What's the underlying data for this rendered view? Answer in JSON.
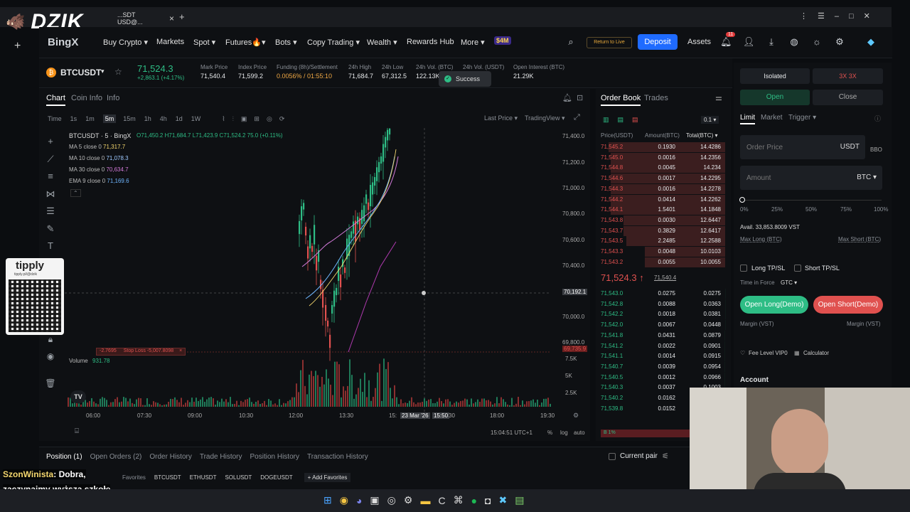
{
  "overlay": {
    "brand": "DZIK",
    "tippy": "tipply",
    "tippy_url": "tipply.pl/@dzik",
    "chat_user": "SzonWinista",
    "chat_msg": ": Dobra, zaczynajmy wyższą szkołę druciarstwa"
  },
  "browser": {
    "tab_title": "...SDT USD@...",
    "close": "×",
    "new_tab": "+"
  },
  "nav": {
    "logo": "BingX",
    "items": [
      "Buy Crypto ▾",
      "Markets",
      "Spot ▾",
      "Futures🔥▾",
      "Bots ▾",
      "Copy Trading ▾",
      "Wealth ▾",
      "Rewards Hub",
      "More ▾"
    ],
    "promo": "$4M",
    "return_live": "Return to Live",
    "deposit": "Deposit",
    "assets": "Assets",
    "notif_count": "11"
  },
  "ticker": {
    "pair": "BTCUSDT",
    "price": "71,524.3",
    "change": "+2,863.1 (+4.17%)",
    "fields": [
      {
        "label": "Mark Price",
        "value": "71,540.4"
      },
      {
        "label": "Index Price",
        "value": "71,599.2"
      },
      {
        "label": "Funding (8h)/Settlement",
        "value": "0.0056% / 01:55:10"
      },
      {
        "label": "24h High",
        "value": "71,684.7"
      },
      {
        "label": "24h Low",
        "value": "67,312.5"
      },
      {
        "label": "24h Vol. (BTC)",
        "value": "122.13K"
      },
      {
        "label": "24h Vol. (USDT)",
        "value": ""
      },
      {
        "label": "Open Interest (BTC)",
        "value": "21.29K"
      }
    ],
    "toast": "Success"
  },
  "chart": {
    "tabs": [
      "Chart",
      "Coin Info",
      "Info"
    ],
    "intervals": [
      "Time",
      "1s",
      "1m",
      "5m",
      "15m",
      "1h",
      "4h",
      "1d",
      "1W"
    ],
    "last_price": "Last Price ▾",
    "view": "TradingView ▾",
    "title": "BTCUSDT · 5 · BingX",
    "ohlc": "O71,450.2 H71,684.7 L71,423.9 C71,524.2 75.0 (+0.11%)",
    "ma": [
      {
        "label": "MA 5 close 0",
        "value": "71,317.7",
        "color": "#f5d76e"
      },
      {
        "label": "MA 10 close 0",
        "value": "71,078.3",
        "color": "#9ec9ff"
      },
      {
        "label": "MA 30 close 0",
        "value": "70,634.7",
        "color": "#d27ad9"
      },
      {
        "label": "EMA 9 close 0",
        "value": "71,169.6",
        "color": "#6fb6ff"
      }
    ],
    "y_ticks": [
      "71,400.0",
      "71,200.0",
      "71,000.0",
      "70,800.0",
      "70,600.0",
      "70,400.0",
      "70,192.1",
      "70,000.0",
      "69,800.0",
      "69,735.9"
    ],
    "vol_ticks": [
      "7.5K",
      "5K",
      "2.5K"
    ],
    "x_ticks": [
      "06:00",
      "07:30",
      "09:00",
      "10:30",
      "12:00",
      "13:30",
      "15:",
      "23 Mar '26",
      "15:50",
      "30",
      "18:00",
      "19:30"
    ],
    "volume": "Volume",
    "volume_val": "931.78",
    "stop_loss": "Stop Loss -5,007.8098",
    "stop_val": "-2.7695",
    "clock": "15:04:51 UTC+1",
    "pct": "%",
    "log": "log",
    "auto": "auto"
  },
  "orderbook": {
    "tabs": [
      "Order Book",
      "Trades"
    ],
    "precision": "0.1 ▾",
    "headers": [
      "Price(USDT)",
      "Amount(BTC)",
      "Total(BTC) ▾"
    ],
    "asks": [
      [
        "71,545.2",
        "0.1930",
        "14.4286"
      ],
      [
        "71,545.0",
        "0.0016",
        "14.2356"
      ],
      [
        "71,544.8",
        "0.0045",
        "14.234"
      ],
      [
        "71,544.6",
        "0.0017",
        "14.2295"
      ],
      [
        "71,544.3",
        "0.0016",
        "14.2278"
      ],
      [
        "71,544.2",
        "0.0414",
        "14.2262"
      ],
      [
        "71,544.1",
        "1.5401",
        "14.1848"
      ],
      [
        "71,543.8",
        "0.0030",
        "12.6447"
      ],
      [
        "71,543.7",
        "0.3829",
        "12.6417"
      ],
      [
        "71,543.5",
        "2.2485",
        "12.2588"
      ],
      [
        "71,543.3",
        "0.0048",
        "10.0103"
      ],
      [
        "71,543.2",
        "0.0055",
        "10.0055"
      ]
    ],
    "last": "71,524.3 ↑",
    "last_sub": "71,540.4",
    "bids": [
      [
        "71,543.0",
        "0.0275",
        "0.0275"
      ],
      [
        "71,542.8",
        "0.0088",
        "0.0363"
      ],
      [
        "71,542.2",
        "0.0018",
        "0.0381"
      ],
      [
        "71,542.0",
        "0.0067",
        "0.0448"
      ],
      [
        "71,541.8",
        "0.0431",
        "0.0879"
      ],
      [
        "71,541.2",
        "0.0022",
        "0.0901"
      ],
      [
        "71,541.1",
        "0.0014",
        "0.0915"
      ],
      [
        "71,540.7",
        "0.0039",
        "0.0954"
      ],
      [
        "71,540.5",
        "0.0012",
        "0.0966"
      ],
      [
        "71,540.3",
        "0.0037",
        "0.1003"
      ],
      [
        "71,540.2",
        "0.0162",
        "0.1165"
      ],
      [
        "71,539.8",
        "0.0152",
        "0.1317"
      ]
    ],
    "ratio": "B 1%"
  },
  "trade": {
    "mode": "Isolated",
    "leverage": "3X  3X",
    "open": "Open",
    "close": "Close",
    "types": [
      "Limit",
      "Market",
      "Trigger ▾"
    ],
    "order_price": "Order Price",
    "unit": "USDT",
    "bbo": "BBO",
    "amount": "Amount",
    "amount_unit": "BTC ▾",
    "slider": [
      "0%",
      "25%",
      "50%",
      "75%",
      "100%"
    ],
    "avail": "Avail. 33,853.8009 VST",
    "max_long": "Max Long (BTC)",
    "max_short": "Max Short (BTC)",
    "long_tp": "Long TP/SL",
    "short_tp": "Short TP/SL",
    "tif": "Time in Force",
    "tif_val": "GTC ▾",
    "btn_long": "Open Long(Demo)",
    "btn_short": "Open Short(Demo)",
    "margin_l": "Margin (VST)",
    "margin_r": "Margin (VST)",
    "fee": "Fee Level VIP0",
    "calc": "Calculator",
    "account": "Account"
  },
  "bottom": {
    "tabs": [
      "Position (1)",
      "Open Orders (2)",
      "Order History",
      "Trade History",
      "Position History",
      "Transaction History"
    ],
    "current_pair": "Current pair",
    "favorites": [
      "Favorites",
      "BTCUSDT",
      "ETHUSDT",
      "SOLUSDT",
      "DOGEUSDT"
    ],
    "add_fav": "+ Add Favorites"
  }
}
